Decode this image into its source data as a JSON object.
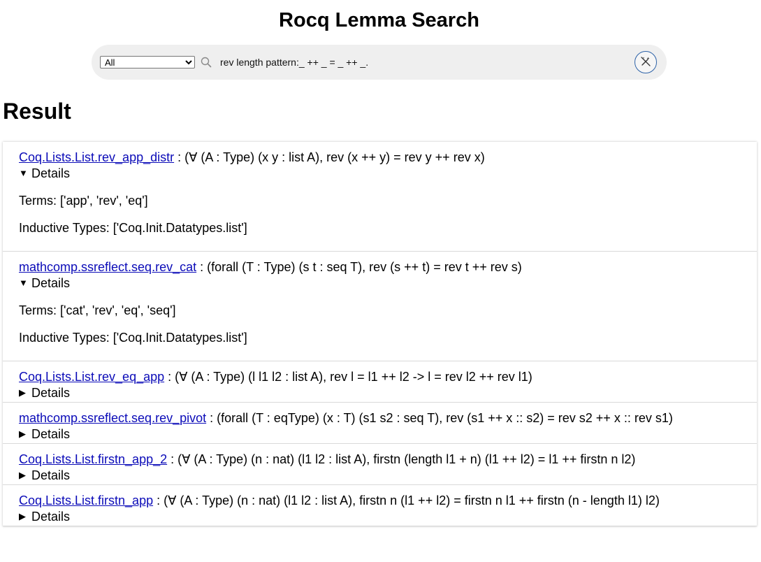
{
  "page": {
    "title": "Rocq Lemma Search"
  },
  "search": {
    "filter": "All",
    "filter_options": [
      "All"
    ],
    "query": "rev length pattern:_ ++ _ = _ ++ _."
  },
  "results_heading": "Result",
  "details_label": "Details",
  "results": [
    {
      "name": "Coq.Lists.List.rev_app_distr",
      "signature": " : (∀ (A : Type) (x y : list A), rev (x ++ y) = rev y ++ rev x)",
      "open": true,
      "terms": "Terms: ['app', 'rev', 'eq']",
      "inductive": "Inductive Types: ['Coq.Init.Datatypes.list']"
    },
    {
      "name": "mathcomp.ssreflect.seq.rev_cat",
      "signature": " : (forall (T : Type) (s t : seq T), rev (s ++ t) = rev t ++ rev s)",
      "open": true,
      "terms": "Terms: ['cat', 'rev', 'eq', 'seq']",
      "inductive": "Inductive Types: ['Coq.Init.Datatypes.list']"
    },
    {
      "name": "Coq.Lists.List.rev_eq_app",
      "signature": " : (∀ (A : Type) (l l1 l2 : list A), rev l = l1 ++ l2 -> l = rev l2 ++ rev l1)",
      "open": false
    },
    {
      "name": "mathcomp.ssreflect.seq.rev_pivot",
      "signature": " : (forall (T : eqType) (x : T) (s1 s2 : seq T), rev (s1 ++ x :: s2) = rev s2 ++ x :: rev s1)",
      "open": false
    },
    {
      "name": "Coq.Lists.List.firstn_app_2",
      "signature": " : (∀ (A : Type) (n : nat) (l1 l2 : list A), firstn (length l1 + n) (l1 ++ l2) = l1 ++ firstn n l2)",
      "open": false
    },
    {
      "name": "Coq.Lists.List.firstn_app",
      "signature": " : (∀ (A : Type) (n : nat) (l1 l2 : list A), firstn n (l1 ++ l2) = firstn n l1 ++ firstn (n - length l1) l2)",
      "open": false
    }
  ]
}
